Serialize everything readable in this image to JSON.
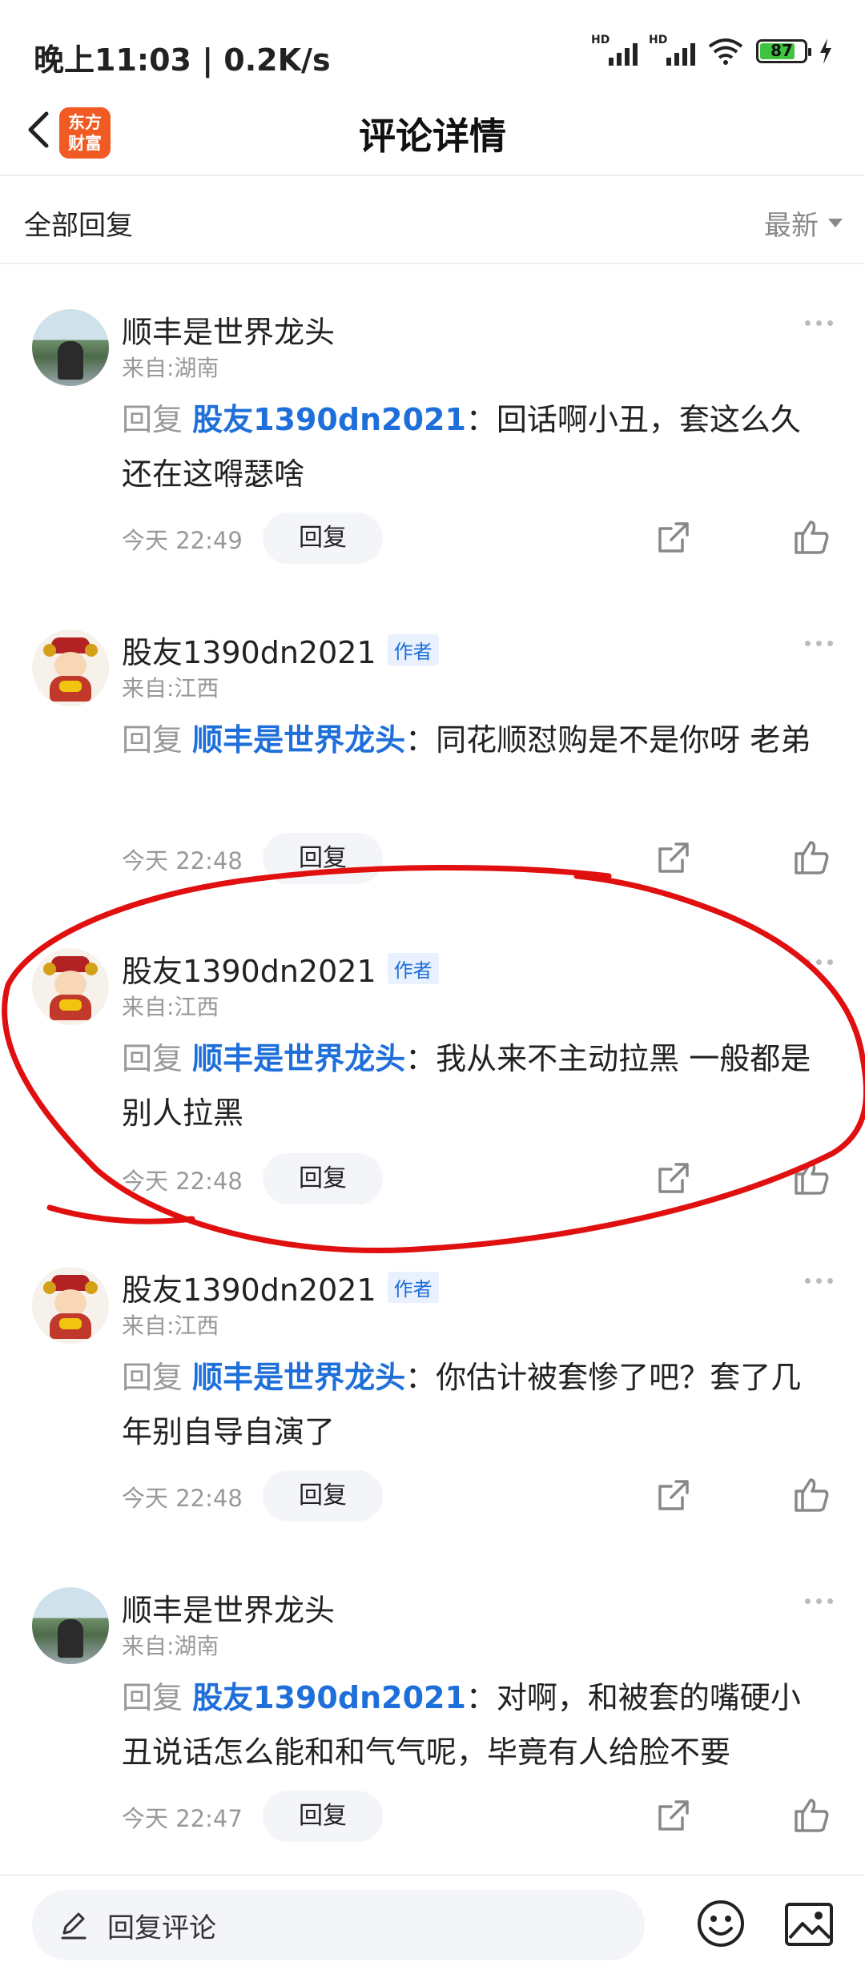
{
  "status_bar": {
    "time": "晚上11:03 | 0.2K/s",
    "network_labels": [
      "HD",
      "HD"
    ],
    "battery": "87"
  },
  "nav": {
    "logo_text": [
      "东方",
      "财富"
    ],
    "title": "评论详情"
  },
  "filter": {
    "label": "全部回复",
    "sort": "最新"
  },
  "comments": [
    {
      "username": "顺丰是世界龙头",
      "is_author": false,
      "location": "来自:湖南",
      "reply_prefix": "回复",
      "reply_to": "股友1390dn2021",
      "text": "：回话啊小丑，套这么久还在这嘚瑟啥",
      "time": "今天 22:49",
      "reply_label": "回复"
    },
    {
      "username": "股友1390dn2021",
      "is_author": true,
      "location": "来自:江西",
      "reply_prefix": "回复",
      "reply_to": "顺丰是世界龙头",
      "text": "：同花顺怼购是不是你呀 老弟",
      "time": "今天 22:48",
      "reply_label": "回复"
    },
    {
      "username": "股友1390dn2021",
      "is_author": true,
      "location": "来自:江西",
      "reply_prefix": "回复",
      "reply_to": "顺丰是世界龙头",
      "text": "：我从来不主动拉黑 一般都是别人拉黑",
      "time": "今天 22:48",
      "reply_label": "回复"
    },
    {
      "username": "股友1390dn2021",
      "is_author": true,
      "location": "来自:江西",
      "reply_prefix": "回复",
      "reply_to": "顺丰是世界龙头",
      "text": "：你估计被套惨了吧？套了几年别自导自演了",
      "time": "今天 22:48",
      "reply_label": "回复"
    },
    {
      "username": "顺丰是世界龙头",
      "is_author": false,
      "location": "来自:湖南",
      "reply_prefix": "回复",
      "reply_to": "股友1390dn2021",
      "text": "：对啊，和被套的嘴硬小丑说话怎么能和和气气呢，毕竟有人给脸不要",
      "time": "今天 22:47",
      "reply_label": "回复"
    }
  ],
  "author_badge": "作者",
  "bottom_bar": {
    "reply_placeholder": "回复评论"
  },
  "colors": {
    "mention": "#1e6fd9",
    "annotation": "#e11010",
    "logo": "#f15a22"
  }
}
